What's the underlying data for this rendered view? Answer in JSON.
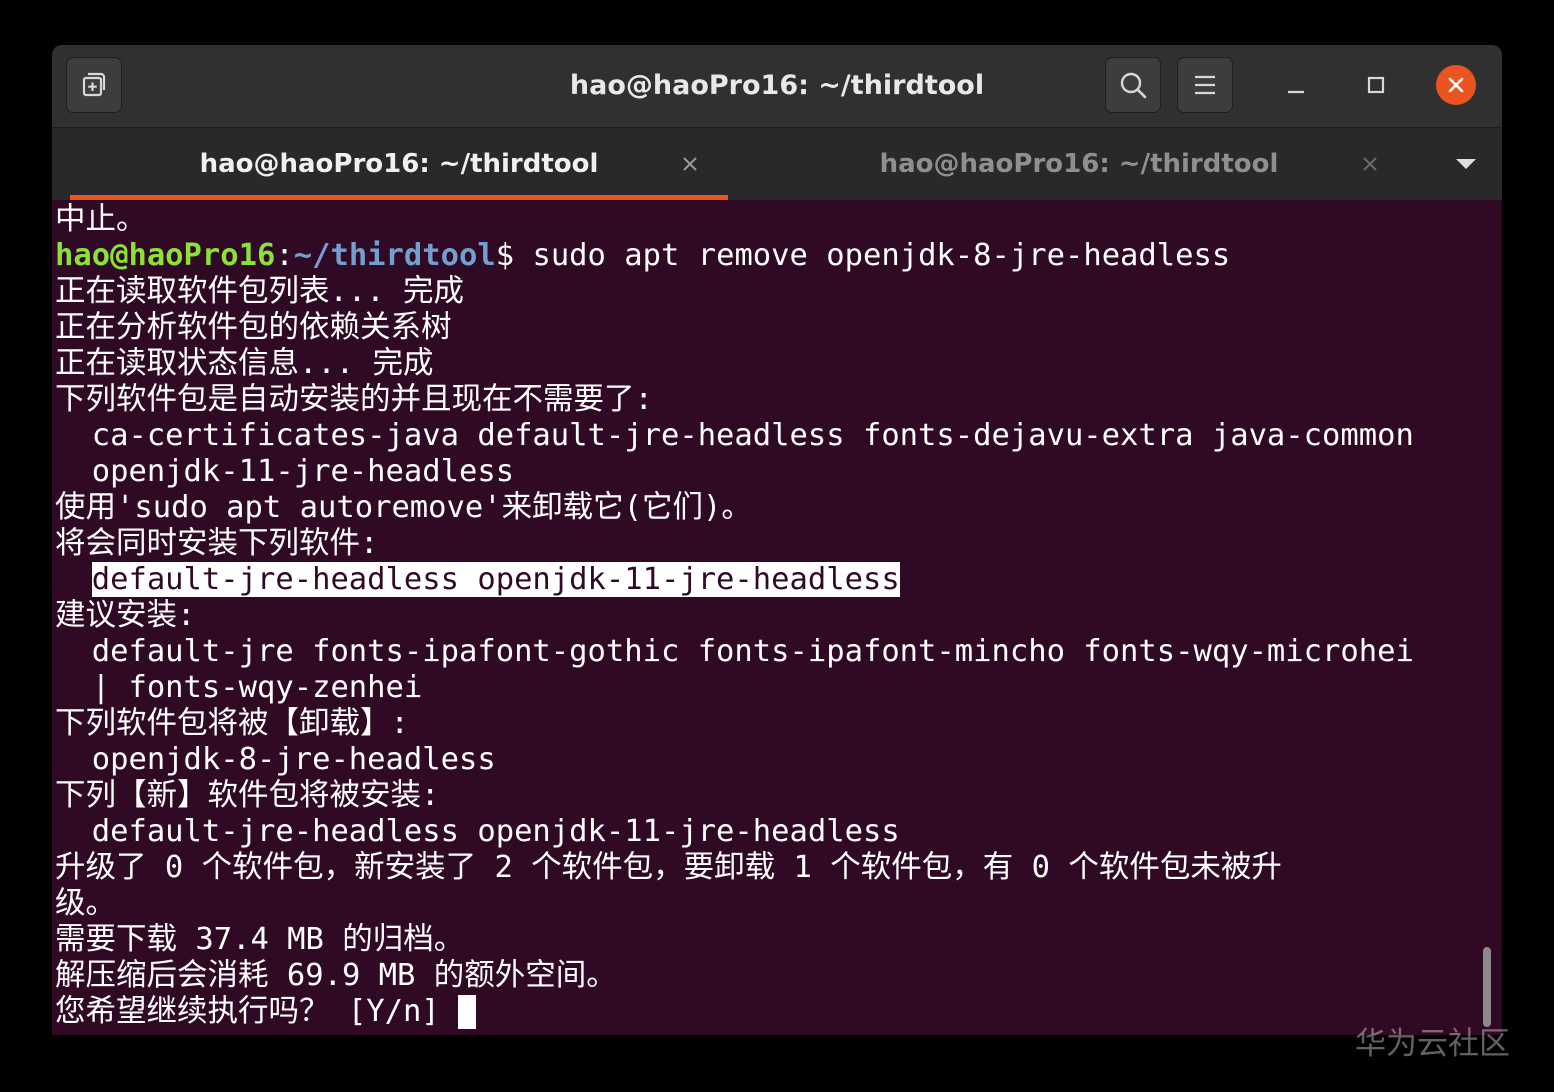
{
  "window": {
    "title": "hao@haoPro16: ~/thirdtool",
    "accent_color": "#e95420",
    "terminal_bg": "#300a24"
  },
  "titlebar": {
    "new_tab_icon": "new-tab-icon",
    "search_icon": "search-icon",
    "menu_icon": "hamburger-menu-icon",
    "minimize_icon": "minimize-icon",
    "maximize_icon": "maximize-icon",
    "close_icon": "close-icon"
  },
  "tabs": [
    {
      "label": "hao@haoPro16: ~/thirdtool",
      "active": true
    },
    {
      "label": "hao@haoPro16: ~/thirdtool",
      "active": false
    }
  ],
  "terminal": {
    "lines": [
      [
        {
          "t": "中止。"
        }
      ],
      [
        {
          "t": "hao@haoPro16",
          "s": "user"
        },
        {
          "t": ":"
        },
        {
          "t": "~/thirdtool",
          "s": "path"
        },
        {
          "t": "$ sudo apt remove openjdk-8-jre-headless"
        }
      ],
      [
        {
          "t": "正在读取软件包列表... 完成"
        }
      ],
      [
        {
          "t": "正在分析软件包的依赖关系树"
        }
      ],
      [
        {
          "t": "正在读取状态信息... 完成"
        }
      ],
      [
        {
          "t": "下列软件包是自动安装的并且现在不需要了:"
        }
      ],
      [
        {
          "t": "  ca-certificates-java default-jre-headless fonts-dejavu-extra java-common"
        }
      ],
      [
        {
          "t": "  openjdk-11-jre-headless"
        }
      ],
      [
        {
          "t": "使用'sudo apt autoremove'来卸载它(它们)。"
        }
      ],
      [
        {
          "t": "将会同时安装下列软件:"
        }
      ],
      [
        {
          "t": "  "
        },
        {
          "t": "default-jre-headless openjdk-11-jre-headless",
          "s": "hl"
        }
      ],
      [
        {
          "t": "建议安装:"
        }
      ],
      [
        {
          "t": "  default-jre fonts-ipafont-gothic fonts-ipafont-mincho fonts-wqy-microhei"
        }
      ],
      [
        {
          "t": "  | fonts-wqy-zenhei"
        }
      ],
      [
        {
          "t": "下列软件包将被【卸载】:"
        }
      ],
      [
        {
          "t": "  openjdk-8-jre-headless"
        }
      ],
      [
        {
          "t": "下列【新】软件包将被安装:"
        }
      ],
      [
        {
          "t": "  default-jre-headless openjdk-11-jre-headless"
        }
      ],
      [
        {
          "t": "升级了 0 个软件包，新安装了 2 个软件包，要卸载 1 个软件包，有 0 个软件包未被升"
        }
      ],
      [
        {
          "t": "级。"
        }
      ],
      [
        {
          "t": "需要下载 37.4 MB 的归档。"
        }
      ],
      [
        {
          "t": "解压缩后会消耗 69.9 MB 的额外空间。"
        }
      ],
      [
        {
          "t": "您希望继续执行吗？ [Y/n] "
        }
      ]
    ]
  },
  "watermark": "华为云社区"
}
